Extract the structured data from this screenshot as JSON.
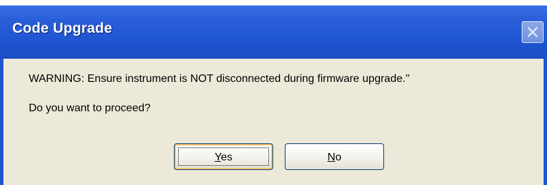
{
  "dialog": {
    "title": "Code Upgrade",
    "warning": "WARNING: Ensure instrument is NOT disconnected during firmware upgrade.\"",
    "question": "Do you want to proceed?",
    "buttons": {
      "yes": {
        "mnemonic": "Y",
        "rest": "es"
      },
      "no": {
        "mnemonic": "N",
        "rest": "o"
      }
    },
    "close_icon": "close-icon"
  },
  "colors": {
    "titlebar": "#1f55d2",
    "background": "#ECE9D8",
    "button_border": "#003c74",
    "focus_highlight": "#f4c26b"
  }
}
